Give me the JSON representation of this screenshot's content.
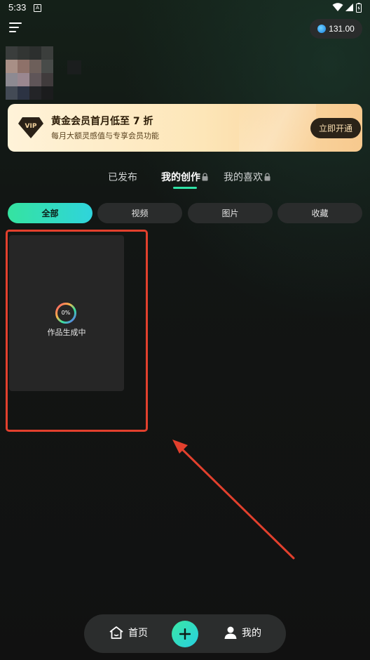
{
  "status_bar": {
    "time": "5:33",
    "app_icon_letter": "A"
  },
  "header": {
    "coin_balance": "131.00"
  },
  "vip_banner": {
    "title": "黄金会员首月低至 7 折",
    "subtitle": "每月大额灵感值与专享会员功能",
    "badge_text": "VIP",
    "button_label": "立即开通"
  },
  "tabs": [
    {
      "label": "已发布",
      "locked": false
    },
    {
      "label": "我的创作",
      "locked": true,
      "active": true
    },
    {
      "label": "我的喜欢",
      "locked": true
    }
  ],
  "filters": [
    {
      "label": "全部",
      "active": true
    },
    {
      "label": "视频"
    },
    {
      "label": "图片"
    },
    {
      "label": "收藏"
    }
  ],
  "work_item": {
    "progress_label": "0%",
    "progress": 0,
    "status_text": "作品生成中"
  },
  "bottom_nav": {
    "home_label": "首页",
    "mine_label": "我的"
  },
  "colors": {
    "accent": "#2fe3a6",
    "annotation": "#e2402d"
  }
}
